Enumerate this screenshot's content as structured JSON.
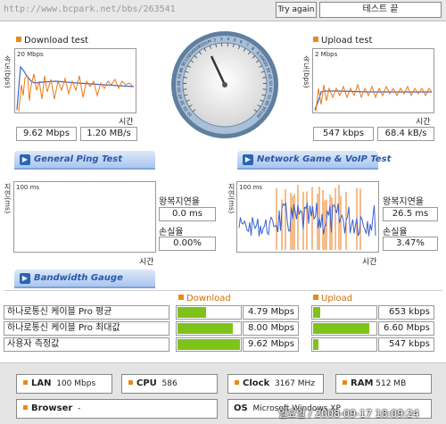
{
  "top": {
    "url": "http://www.bcpark.net/bbs/263541",
    "try_again_label": "Try again",
    "status_text": "테스트 끝"
  },
  "download": {
    "title": "Download test",
    "ylabel": "속도(bps)",
    "ymax_label": "20 Mbps",
    "xlabel": "시간",
    "speed_bps": "9.62 Mbps",
    "speed_bytes": "1.20 MB/s"
  },
  "upload": {
    "title": "Upload test",
    "ylabel": "속도(bps)",
    "ymax_label": "2 Mbps",
    "xlabel": "시간",
    "speed_bps": "547 kbps",
    "speed_bytes": "68.4 kB/s"
  },
  "gauge": {
    "ticks": [
      "10",
      "20",
      "30",
      "40",
      "50",
      "60",
      "70",
      "80",
      "90",
      "100",
      "200",
      "300",
      "500",
      "1M",
      "2",
      "3",
      "4",
      "5",
      "6",
      "7",
      "8",
      "9",
      "10M",
      "20",
      "30",
      "40",
      "50",
      "60",
      "70",
      "80",
      "90",
      "100"
    ]
  },
  "ping": {
    "tab_label": "General Ping Test",
    "ylabel": "지연(ms)",
    "ymax_label": "100 ms",
    "xlabel": "시간",
    "rtt_label": "왕복지연율",
    "rtt_value": "0.0 ms",
    "loss_label": "손실율",
    "loss_value": "0.00%"
  },
  "game": {
    "tab_label": "Network Game & VoIP Test",
    "ylabel": "지연(ms)",
    "ymax_label": "100 ms",
    "xlabel": "시간",
    "rtt_label": "왕복지연율",
    "rtt_value": "26.5 ms",
    "loss_label": "손실율",
    "loss_value": "3.47%"
  },
  "gauge_tab": {
    "tab_label": "Bandwidth Gauge",
    "xlabel": "시간"
  },
  "bandwidth": {
    "download_header": "Download",
    "upload_header": "Upload",
    "rows": [
      {
        "label": "하나로통신 케이블 Pro 평균",
        "down": "4.79 Mbps",
        "down_frac": 0.45,
        "up": "653 kbps",
        "up_frac": 0.11
      },
      {
        "label": "하나로통신 케이블 Pro 최대값",
        "down": "8.00 Mbps",
        "down_frac": 0.88,
        "up": "6.60 Mbps",
        "up_frac": 0.9
      },
      {
        "label": "사용자 측정값",
        "down": "9.62 Mbps",
        "down_frac": 1.0,
        "up": "547 kbps",
        "up_frac": 0.09
      }
    ]
  },
  "info": {
    "lan_label": "LAN",
    "lan_value": "100 Mbps",
    "cpu_label": "CPU",
    "cpu_value": "586",
    "clock_label": "Clock",
    "clock_value": "3167 MHz",
    "ram_label": "RAM",
    "ram_value": "512 MB",
    "browser_label": "Browser",
    "browser_value": "-",
    "os_label": "OS",
    "os_value": "Microsoft Windows XP",
    "datetime": "일요일 / 2008-09-17 18:09:24"
  },
  "colors": {
    "accent_orange": "#e88b1a",
    "series_blue": "#3a63d6",
    "series_orange": "#e87a18",
    "bar_green": "#7fc21a",
    "tab_blue": "#2a58a8"
  }
}
